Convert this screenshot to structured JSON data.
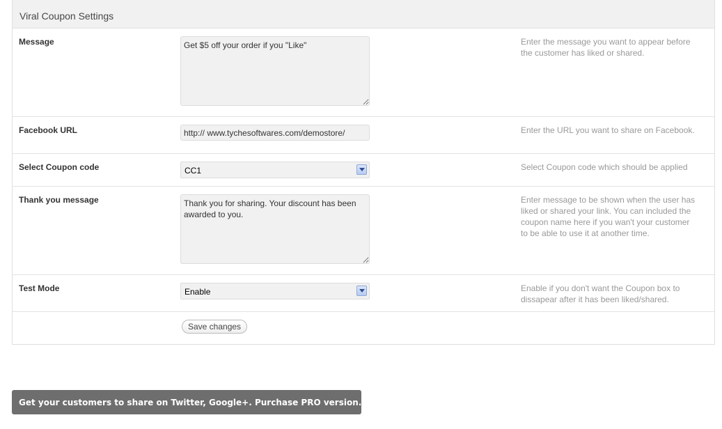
{
  "panel": {
    "title": "Viral Coupon Settings"
  },
  "rows": [
    {
      "label": "Message",
      "value": "Get $5 off your order if you \"Like\"",
      "description": "Enter the message you want to appear before the customer has liked or shared."
    },
    {
      "label": "Facebook URL",
      "value": "http:// www.tychesoftwares.com/demostore/",
      "description": "Enter the URL you want to share on Facebook."
    },
    {
      "label": "Select Coupon code",
      "value": "CC1",
      "description": "Select Coupon code which should be applied"
    },
    {
      "label": "Thank you message",
      "value": "Thank you for sharing. Your discount has been awarded to you.",
      "description": "Enter message to be shown when the user has liked or shared your link. You can included the coupon name here if you wan't your customer to be able to use it at another time."
    },
    {
      "label": "Test Mode",
      "value": "Enable",
      "description": "Enable if you don't want the Coupon box to dissapear after it has been liked/shared."
    }
  ],
  "actions": {
    "save_label": "Save changes"
  },
  "promo": {
    "text": "Get your customers to share on Twitter, Google+. Purchase PRO version."
  },
  "icons": {
    "dropdown": "chevron-down-icon",
    "resize": "resize-handle-icon"
  },
  "colors": {
    "header_bg": "#f1f1f1",
    "field_bg": "#f1f1f1",
    "description_text": "#999999",
    "promo_bg": "#6e6e6e",
    "dropdown_arrow": "#b7caf1"
  }
}
